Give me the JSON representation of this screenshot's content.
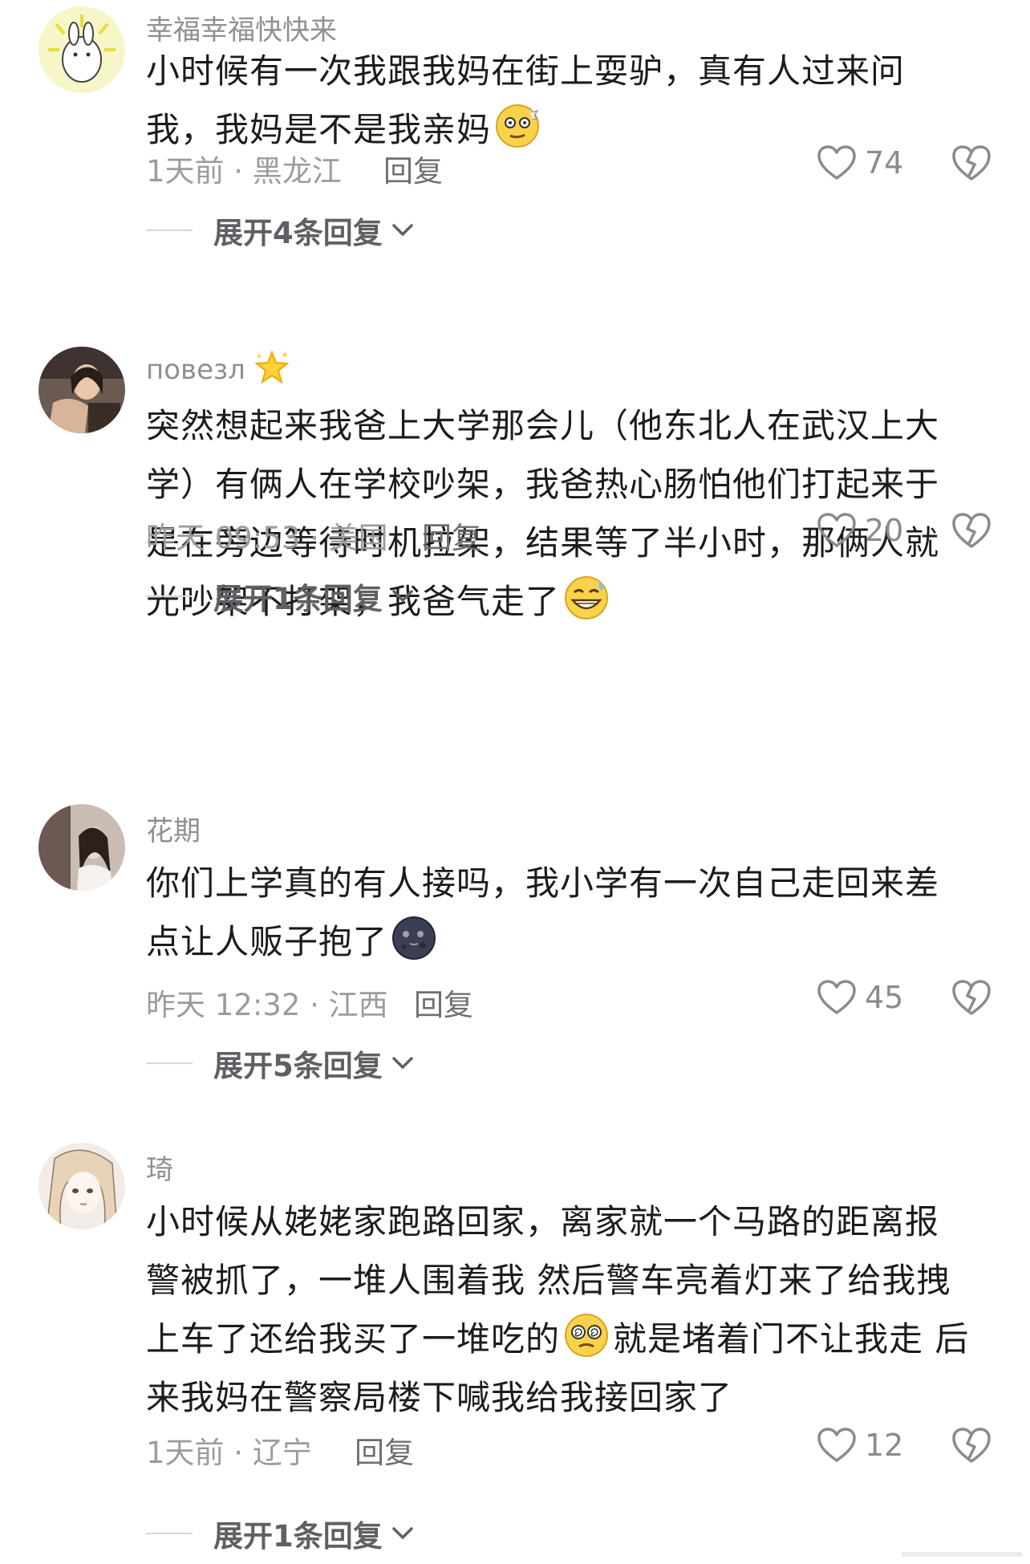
{
  "colors": {
    "text": "#1c1c1c",
    "meta": "#9b9ba0",
    "reply": "#6e6e73",
    "expand": "#5f5f64",
    "icon": "#8a8a8f"
  },
  "comments": [
    {
      "username": "幸福幸福快快来",
      "lines": [
        "小时候有一次我跟我妈在街上耍驴，真有人过来问",
        "我，我妈是不是我亲妈"
      ],
      "emoji": "dizzy-face-emoji",
      "meta": "1天前 · 黑龙江",
      "reply": "回复",
      "likes": "74",
      "expand": "展开4条回复"
    },
    {
      "username": "повезл",
      "username_badge": "star-sparkle-emoji",
      "lines": [
        "突然想起来我爸上大学那会儿（他东北人在武汉上大",
        "学）有俩人在学校吵架，我爸热心肠怕他们打起来于",
        "是在旁边等待时机拉架，结果等了半小时，那俩人就",
        "光吵架不打架，我爸气走了"
      ],
      "emoji": "grinning-sweat-emoji",
      "meta": "昨天 09:53 · 美国",
      "reply": "回复",
      "likes": "20",
      "expand": "展开1条回复"
    },
    {
      "username": "花期",
      "lines": [
        "你们上学真的有人接吗，我小学有一次自己走回来差",
        "点让人贩子抱了"
      ],
      "emoji": "new-moon-face-emoji",
      "meta": "昨天 12:32 · 江西",
      "reply": "回复",
      "likes": "45",
      "expand": "展开5条回复"
    },
    {
      "username": "琦",
      "lines": [
        "小时候从姥姥家跑路回家，离家就一个马路的距离报",
        "警被抓了，一堆人围着我 然后警车亮着灯来了给我拽",
        "上车了还给我买了一堆吃的",
        "来我妈在警察局楼下喊我给我接回家了"
      ],
      "line3_tail": "就是堵着门不让我走 后",
      "emoji": "spiral-eyes-emoji",
      "meta": "1天前 · 辽宁",
      "reply": "回复",
      "likes": "12",
      "expand": "展开1条回复"
    }
  ]
}
